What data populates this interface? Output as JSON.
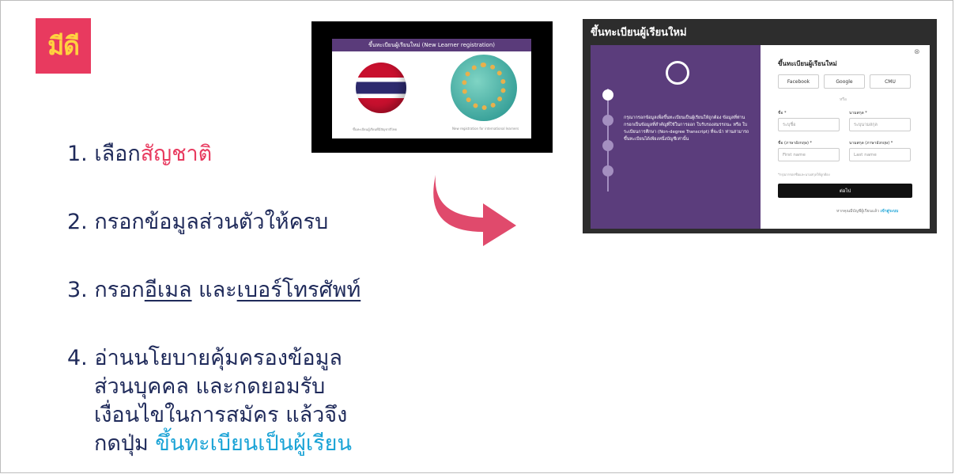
{
  "logo": {
    "text": "มีดี",
    "bg_color": "#e83a5f",
    "text_color": "#ffd23f"
  },
  "steps": [
    {
      "num": "1.",
      "pre": "เลือก",
      "highlight": "สัญชาติ"
    },
    {
      "num": "2.",
      "text": "กรอกข้อมูลส่วนตัวให้ครบ"
    },
    {
      "num": "3.",
      "pre": "กรอก",
      "u1": "อีเมล",
      "mid": " และ",
      "u2": "เบอร์โทรศัพท์"
    },
    {
      "num": "4.",
      "lines": [
        "อ่านนโยบายคุ้มครองข้อมูล",
        "ส่วนบุคคล และกดยอมรับ",
        "เงื่อนไขในการสมัคร แล้วจึง"
      ],
      "last_pre": "กดปุ่ม ",
      "last_highlight": "ขึ้นทะเบียนเป็นผู้เรียน"
    }
  ],
  "thumbnail": {
    "title": "ขึ้นทะเบียนผู้เรียนใหม่ (New Learner registration)",
    "caption_left": "ขึ้นทะเบียนผู้เรียนที่มีสัญชาติไทย",
    "caption_right": "New registration for international learners"
  },
  "screenshot": {
    "window_title": "ขึ้นทะเบียนผู้เรียนใหม่",
    "left_text": "กรุณากรอกข้อมูลเพื่อขึ้นทะเบียนเป็นผู้เรียนให้ถูกต้อง ข้อมูลที่ท่านกรอกเป็นข้อมูลที่สำคัญที่ใช้ในการออก ใบรับรองสมรรถนะ หรือ ใบระเบียนการศึกษา (Non-degree Transcript) ที่จะนำ ท่านสามารถขึ้นทะเบียนได้เพียงหนึ่งบัญชีเท่านั้น",
    "steps": [
      "1",
      "2",
      "3",
      "4"
    ],
    "form_title": "ขึ้นทะเบียนผู้เรียนใหม่",
    "social": [
      "Facebook",
      "Google",
      "CMU"
    ],
    "or_label": "หรือ",
    "first_name_label": "ชื่อ *",
    "last_name_label": "นามสกุล *",
    "first_name_placeholder": "ระบุชื่อ",
    "last_name_placeholder": "ระบุนามสกุล",
    "first_name_en_label": "ชื่อ (ภาษาอังกฤษ) *",
    "last_name_en_label": "นามสกุล (ภาษาอังกฤษ) *",
    "first_name_en_placeholder": "First name",
    "last_name_en_placeholder": "Last name",
    "hint": "*กรุณากรอกชื่อและนามสกุลให้ถูกต้อง",
    "submit_label": "ต่อไป",
    "login_prompt": "หากคุณมีบัญชีผู้เรียนแล้ว",
    "login_link": "เข้าสู่ระบบ"
  }
}
